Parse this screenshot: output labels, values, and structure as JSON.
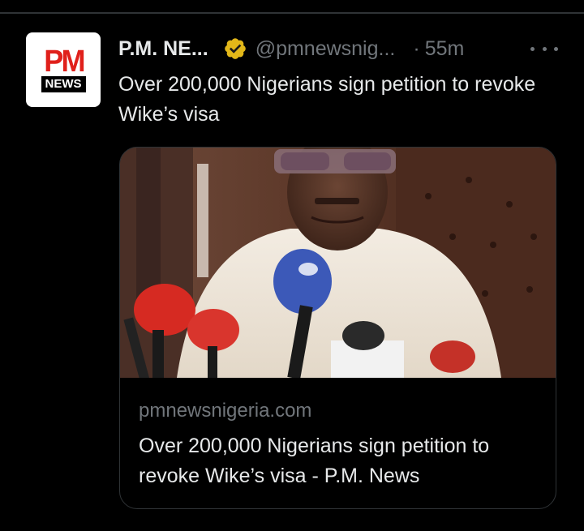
{
  "tweet": {
    "author_name": "P.M. NE...",
    "handle": "@pmnewsnig...",
    "separator": "·",
    "time": "55m",
    "text": "Over 200,000 Nigerians sign petition to revoke Wike’s visa"
  },
  "avatar": {
    "logo_top": "PM",
    "logo_bottom": "NEWS"
  },
  "card": {
    "domain": "pmnewsnigeria.com",
    "title": "Over 200,000 Nigerians sign petition to revoke Wike’s visa - P.M. News",
    "image_icon": "press-conference-photo"
  },
  "icons": {
    "verified": "verified-badge-icon",
    "more": "more-options-icon"
  },
  "colors": {
    "background": "#000000",
    "primary_text": "#e7e9ea",
    "secondary_text": "#71767b",
    "border": "#2f3336",
    "verified_gold": "#e2b719",
    "logo_red": "#e0201b"
  }
}
